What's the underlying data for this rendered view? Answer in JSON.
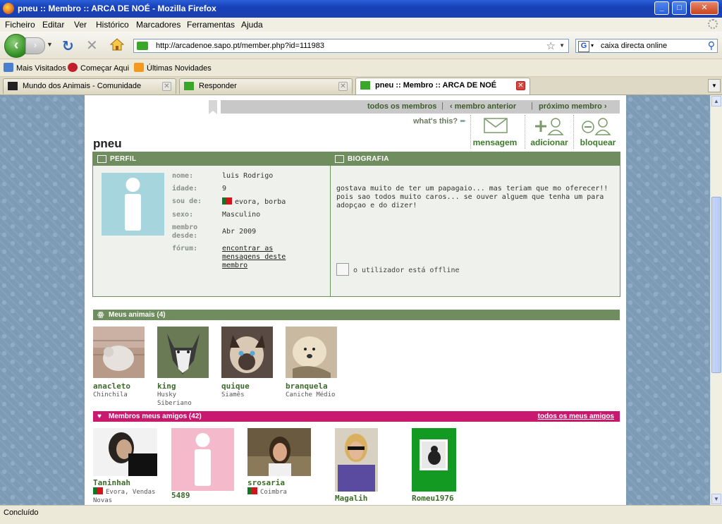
{
  "window": {
    "title": "pneu :: Membro :: ARCA DE NOÉ - Mozilla Firefox",
    "min": "_",
    "max": "□",
    "close": "✕"
  },
  "menu": [
    "Ficheiro",
    "Editar",
    "Ver",
    "Histórico",
    "Marcadores",
    "Ferramentas",
    "Ajuda"
  ],
  "nav": {
    "url": "http://arcadenoe.sapo.pt/member.php?id=111983",
    "search_value": "caixa directa online"
  },
  "bookmarks": [
    "Mais Visitados",
    "Começar Aqui",
    "Últimas Novidades"
  ],
  "tabs": [
    {
      "label": "Mundo dos Animais - Comunidade",
      "active": false
    },
    {
      "label": "Responder",
      "active": false
    },
    {
      "label": "pneu :: Membro :: ARCA DE NOÉ",
      "active": true
    }
  ],
  "page": {
    "topnav": {
      "all_members": "todos os membros",
      "previous": "‹ membro anterior",
      "next": "próximo membro ›",
      "sep": "|"
    },
    "username": "pneu",
    "whats_this": "what's this?",
    "actions": {
      "message": "mensagem",
      "add": "adicionar",
      "block": "bloquear"
    },
    "profile": {
      "heading": "PERFIL",
      "labels": {
        "name": "nome:",
        "age": "idade:",
        "from": "sou de:",
        "sex": "sexo:",
        "member_line1": "membro",
        "member_line2": "desde:",
        "forum": "fórum:"
      },
      "values": {
        "name": "luis Rodrigo",
        "age": "9",
        "from": "evora, borba",
        "sex": "Masculino",
        "member_since": "Abr 2009",
        "forum_link": "encontrar as mensagens deste membro"
      }
    },
    "bio": {
      "heading": "BIOGRAFIA",
      "text": "gostava muito de ter um papagaio... mas teriam que mo oferecer!! pois sao todos muito caros... se ouver alguem que tenha um para adopçao e do dizer!",
      "status": "o utilizador está offline"
    },
    "animals": {
      "heading": "Meus animais (4)",
      "items": [
        {
          "name": "anacleto",
          "breed": "Chinchila"
        },
        {
          "name": "king",
          "breed": "Husky Siberiano"
        },
        {
          "name": "quique",
          "breed": "Siamês"
        },
        {
          "name": "branquela",
          "breed": "Caniche Médio"
        }
      ]
    },
    "friends": {
      "heading": "Membros meus amigos (42)",
      "all_link": "todos os meus amigos",
      "items": [
        {
          "name": "Taninhah",
          "location": "Evora, Vendas Novas"
        },
        {
          "name": "5489",
          "location": ""
        },
        {
          "name": "srosaria",
          "location": "Coimbra"
        },
        {
          "name": "Magalih",
          "location": ""
        },
        {
          "name": "Romeu1976",
          "location": ""
        }
      ]
    }
  },
  "status": "Concluído",
  "colors": {
    "green_header": "#6f8d5e",
    "pink_header": "#c9196e",
    "link_green": "#3d7a2b"
  }
}
